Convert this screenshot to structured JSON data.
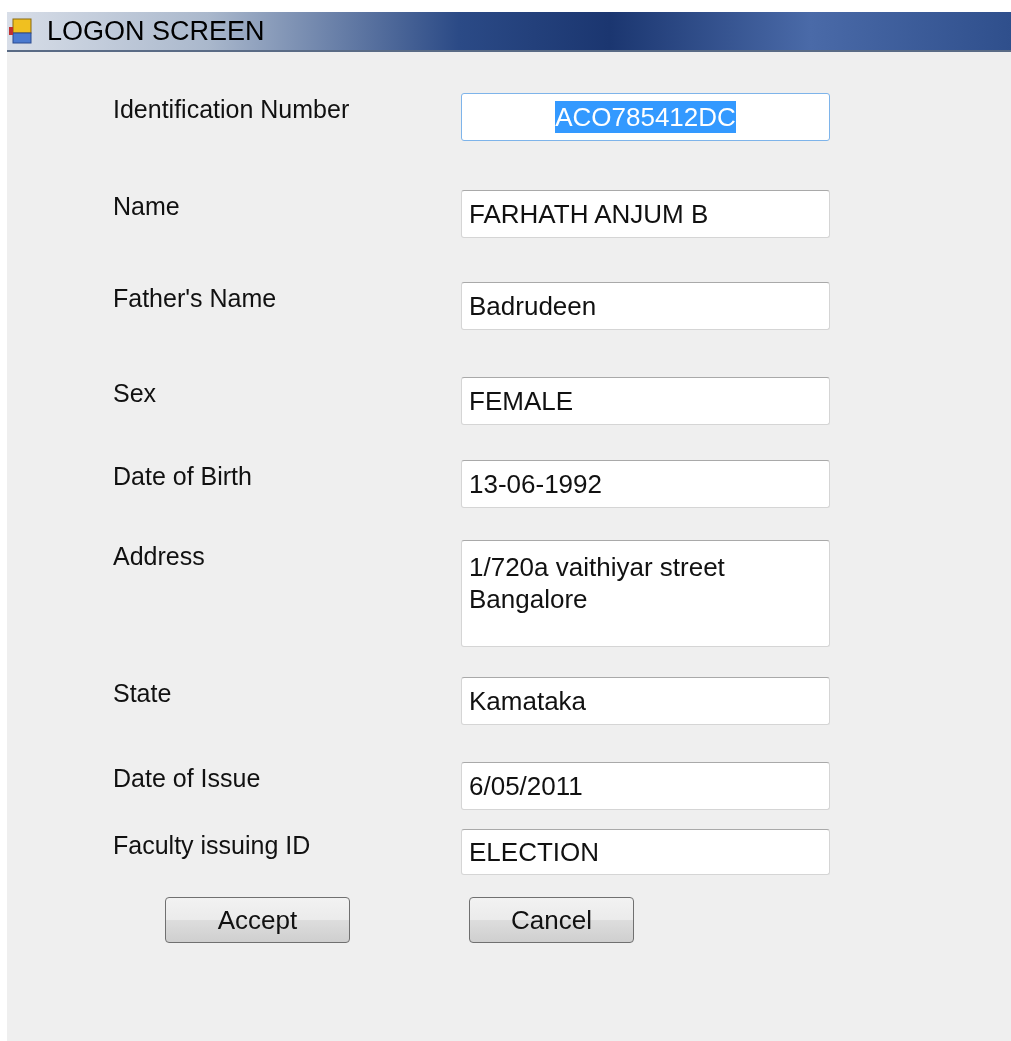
{
  "window": {
    "title": "LOGON SCREEN"
  },
  "fields": [
    {
      "label": "Identification Number",
      "value": "ACO785412DC",
      "highlighted": true,
      "focused": true,
      "kind": "centered"
    },
    {
      "label": "Name",
      "value": "FARHATH ANJUM B",
      "highlighted": false,
      "focused": false,
      "kind": "single"
    },
    {
      "label": "Father's Name",
      "value": "Badrudeen",
      "highlighted": false,
      "focused": false,
      "kind": "single"
    },
    {
      "label": "Sex",
      "value": "FEMALE",
      "highlighted": false,
      "focused": false,
      "kind": "single"
    },
    {
      "label": "Date of Birth",
      "value": "13-06-1992",
      "highlighted": false,
      "focused": false,
      "kind": "single"
    },
    {
      "label": "Address",
      "value": "1/720a vaithiyar street\nBangalore",
      "highlighted": false,
      "focused": false,
      "kind": "multi"
    },
    {
      "label": "State",
      "value": "Kamataka",
      "highlighted": false,
      "focused": false,
      "kind": "single"
    },
    {
      "label": "Date of Issue",
      "value": "6/05/2011",
      "highlighted": false,
      "focused": false,
      "kind": "single"
    },
    {
      "label": "Faculty issuing ID",
      "value": "ELECTION",
      "highlighted": false,
      "focused": false,
      "kind": "single"
    }
  ],
  "buttons": [
    "Accept",
    "Cancel"
  ]
}
